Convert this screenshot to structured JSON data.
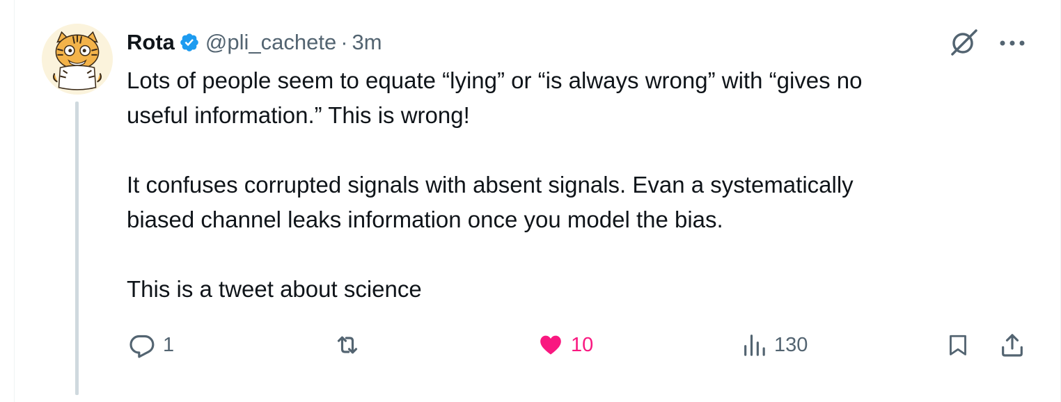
{
  "tweet": {
    "author_name": "Rota",
    "handle": "@pli_cachete",
    "separator": "·",
    "time": "3m",
    "paragraphs": [
      [
        "Lots of people seem to equate “lying” or “is always wrong” with “gives no",
        "useful information.” This is wrong!"
      ],
      [
        "It confuses corrupted signals with absent signals. Evan a systematically",
        "biased channel leaks information once you model the bias."
      ],
      [
        "This is a tweet about science"
      ]
    ],
    "is_verified": true,
    "avatar_icon": "tiger-cartoon-avatar"
  },
  "actions": {
    "reply_count": "1",
    "retweet_count": "",
    "like_count": "10",
    "liked": true,
    "views_count": "130"
  },
  "colors": {
    "text": "#0f1419",
    "secondary": "#536471",
    "verified": "#1d9bf0",
    "like": "#f91880",
    "thread_line": "#cfd9de"
  },
  "icons": [
    "grok-icon",
    "more-icon",
    "reply-icon",
    "retweet-icon",
    "like-icon",
    "views-icon",
    "bookmark-icon",
    "share-icon",
    "verified-badge-icon"
  ]
}
